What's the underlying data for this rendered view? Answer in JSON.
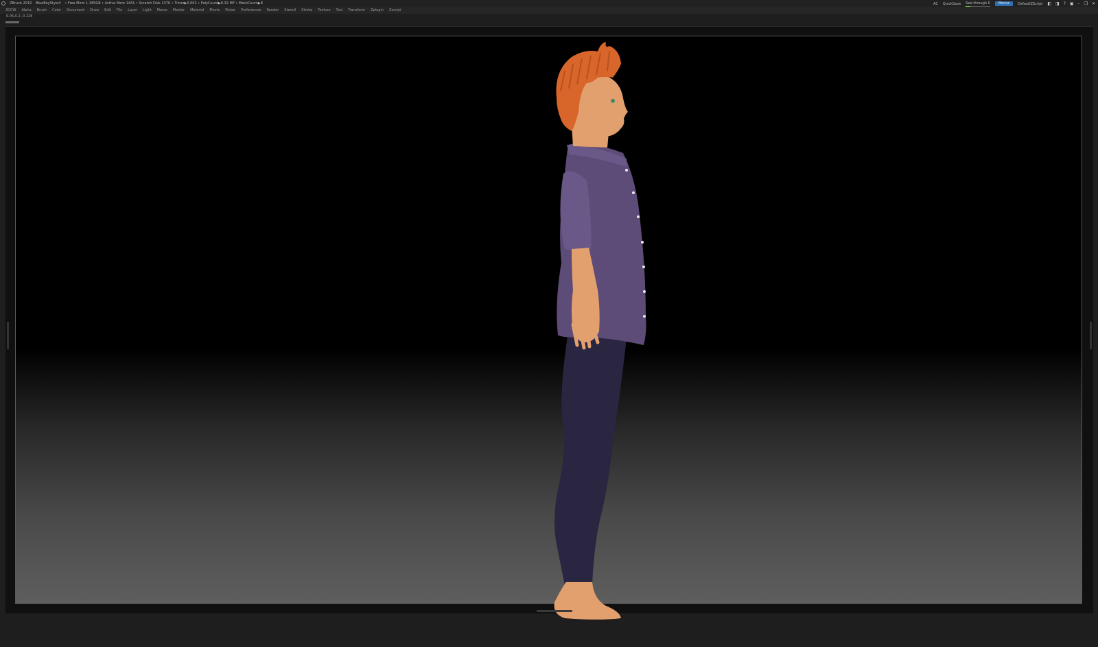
{
  "titlebar": {
    "app_title": "ZBrush 2019",
    "ui_layout": "BlueBoyStyle4",
    "stats": "• Free Mem 1.185GB • Active Mem 1441 • Scratch Disk 1376 • Timer▶0.002 • PolyCount▶8.32 MP • MeshCount▶8",
    "ac_label": "AC",
    "quicksave_label": "QuickSave",
    "see_through_label": "See-through",
    "see_through_value": "0",
    "see_through_fraction": 0.2,
    "menus_label": "Menus",
    "script_label": "DefaultZScript"
  },
  "menubar": {
    "items": [
      "3DCW",
      "Alpha",
      "Brush",
      "Color",
      "Document",
      "Draw",
      "Edit",
      "File",
      "Layer",
      "Light",
      "Macro",
      "Marker",
      "Material",
      "Movie",
      "Picker",
      "Preferences",
      "Render",
      "Stencil",
      "Stroke",
      "Texture",
      "Tool",
      "Transform",
      "Zplugin",
      "Zscript"
    ]
  },
  "viewport": {
    "coords": "0.05,0.2,-0.226",
    "colors": {
      "hair": "#d8662a",
      "skin": "#e3a06f",
      "shirt": "#5e4c78",
      "pants": "#2a2540",
      "eye": "#3f8a6a"
    }
  }
}
